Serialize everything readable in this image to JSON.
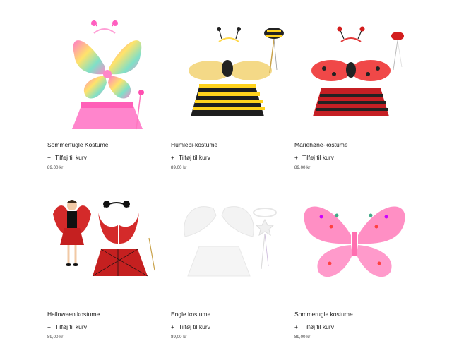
{
  "products": [
    {
      "name": "Sommerfugle Kostume",
      "add_label": "Tilføj til kurv",
      "add_icon": "plus-icon",
      "price": "89,00 kr"
    },
    {
      "name": "Humlebi-kostume",
      "add_label": "Tilføj til kurv",
      "add_icon": "plus-icon",
      "price": "89,00 kr"
    },
    {
      "name": "Mariehøne-kostume",
      "add_label": "Tilføj til kurv",
      "add_icon": "plus-icon",
      "price": "89,00 kr"
    },
    {
      "name": "Halloween kostume",
      "add_label": "Tilføj til kurv",
      "add_icon": "plus-icon",
      "price": "89,00 kr"
    },
    {
      "name": "Engle kostume",
      "add_label": "Tilføj til kurv",
      "add_icon": "plus-icon",
      "price": "89,00 kr"
    },
    {
      "name": "Sommerugle kostume",
      "add_label": "Tilføj til kurv",
      "add_icon": "plus-icon",
      "price": "89,00 kr"
    }
  ],
  "colors": {
    "text": "#222222",
    "price": "#444444",
    "background": "#ffffff"
  }
}
